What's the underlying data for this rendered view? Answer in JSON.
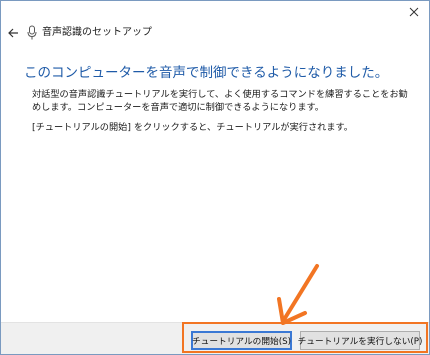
{
  "window": {
    "title": "音声認識のセットアップ"
  },
  "content": {
    "heading": "このコンピューターを音声で制御できるようになりました。",
    "paragraph1": "対話型の音声認識チュートリアルを実行して、よく使用するコマンドを練習することをお勧めします。コンピューターを音声で適切に制御できるようになります。",
    "paragraph2": "[チュートリアルの開始] をクリックすると、チュートリアルが実行されます。"
  },
  "buttons": {
    "start_label": "チュートリアルの開始(S)",
    "skip_label": "チュートリアルを実行しない(P)"
  },
  "icons": {
    "back": "back-arrow-icon",
    "mic": "microphone-icon",
    "close": "close-icon"
  },
  "colors": {
    "heading": "#1f5ba8",
    "highlight": "#f27523",
    "footer_bg": "#f0f0f0"
  }
}
